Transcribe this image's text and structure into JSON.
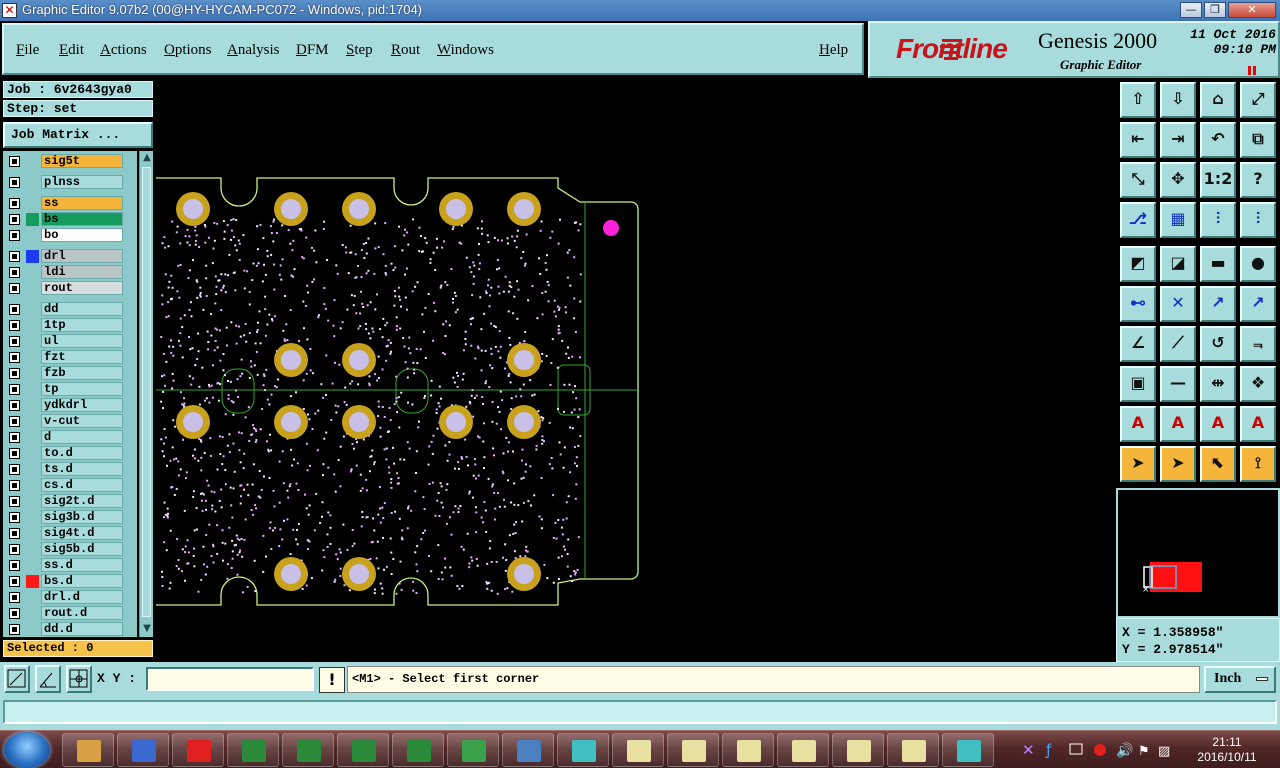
{
  "window": {
    "title": "Graphic Editor 9.07b2 (00@HY-HYCAM-PC072 - Windows, pid:1704)",
    "minimize_glyph": "—",
    "restore_glyph": "❐",
    "close_glyph": "✕"
  },
  "menu": {
    "items": [
      "File",
      "Edit",
      "Actions",
      "Options",
      "Analysis",
      "DFM",
      "Step",
      "Rout",
      "Windows"
    ],
    "help": "Help"
  },
  "brand": {
    "logo": "Frontline",
    "product": "Genesis 2000",
    "subtitle": "Graphic Editor",
    "date": "11 Oct 2016",
    "time": "09:10 PM"
  },
  "job": {
    "job_line": "Job : 6v2643gya0",
    "step_line": "Step: set",
    "matrix_button": "Job Matrix ..."
  },
  "layers": [
    {
      "name": "sig5t",
      "bg": "#f5b53a",
      "swatch": ""
    },
    {
      "name": "plnss",
      "bg": "#a8dcdc",
      "swatch": ""
    },
    {
      "name": "ss",
      "bg": "#f5b53a",
      "swatch": ""
    },
    {
      "name": "bs",
      "bg": "#169c5e",
      "swatch": "#169c5e"
    },
    {
      "name": "bo",
      "bg": "#ffffff",
      "swatch": ""
    },
    {
      "name": "drl",
      "bg": "#b9c4c4",
      "swatch": "#1b3cf0"
    },
    {
      "name": "ldi",
      "bg": "#b9c4c4",
      "swatch": ""
    },
    {
      "name": "rout",
      "bg": "#d6dede",
      "swatch": ""
    },
    {
      "name": "dd",
      "bg": "#a8dcdc",
      "swatch": ""
    },
    {
      "name": "1tp",
      "bg": "#a8dcdc",
      "swatch": ""
    },
    {
      "name": "ul",
      "bg": "#a8dcdc",
      "swatch": ""
    },
    {
      "name": "fzt",
      "bg": "#a8dcdc",
      "swatch": ""
    },
    {
      "name": "fzb",
      "bg": "#a8dcdc",
      "swatch": ""
    },
    {
      "name": "tp",
      "bg": "#a8dcdc",
      "swatch": ""
    },
    {
      "name": "ydkdrl",
      "bg": "#a8dcdc",
      "swatch": ""
    },
    {
      "name": "v-cut",
      "bg": "#a8dcdc",
      "swatch": ""
    },
    {
      "name": "d",
      "bg": "#a8dcdc",
      "swatch": ""
    },
    {
      "name": "to.d",
      "bg": "#a8dcdc",
      "swatch": ""
    },
    {
      "name": "ts.d",
      "bg": "#a8dcdc",
      "swatch": ""
    },
    {
      "name": "cs.d",
      "bg": "#a8dcdc",
      "swatch": ""
    },
    {
      "name": "sig2t.d",
      "bg": "#a8dcdc",
      "swatch": ""
    },
    {
      "name": "sig3b.d",
      "bg": "#a8dcdc",
      "swatch": ""
    },
    {
      "name": "sig4t.d",
      "bg": "#a8dcdc",
      "swatch": ""
    },
    {
      "name": "sig5b.d",
      "bg": "#a8dcdc",
      "swatch": ""
    },
    {
      "name": "ss.d",
      "bg": "#a8dcdc",
      "swatch": ""
    },
    {
      "name": "bs.d",
      "bg": "#a8dcdc",
      "swatch": "#ff1a1a"
    },
    {
      "name": "drl.d",
      "bg": "#a8dcdc",
      "swatch": ""
    },
    {
      "name": "rout.d",
      "bg": "#a8dcdc",
      "swatch": ""
    },
    {
      "name": "dd.d",
      "bg": "#a8dcdc",
      "swatch": ""
    }
  ],
  "selected": "Selected : 0",
  "coords": {
    "x": "X = 1.358958\"",
    "y": "Y = 2.978514\""
  },
  "command": {
    "xy_label": "X Y :",
    "xy_value": "",
    "warn": "!",
    "prompt": "<M1> - Select first corner",
    "unit": "Inch"
  },
  "colors": {
    "panel": "#a8dcdc",
    "active_layer": "#f5b53a",
    "pad_gold": "#c8a21c",
    "pad_drill": "#c8c0e6",
    "outline": "#c8f082",
    "board_edge": "#33a833",
    "marker_magenta": "#ff22dd"
  },
  "taskbar": {
    "clock_time": "21:11",
    "clock_date": "2016/10/11"
  }
}
